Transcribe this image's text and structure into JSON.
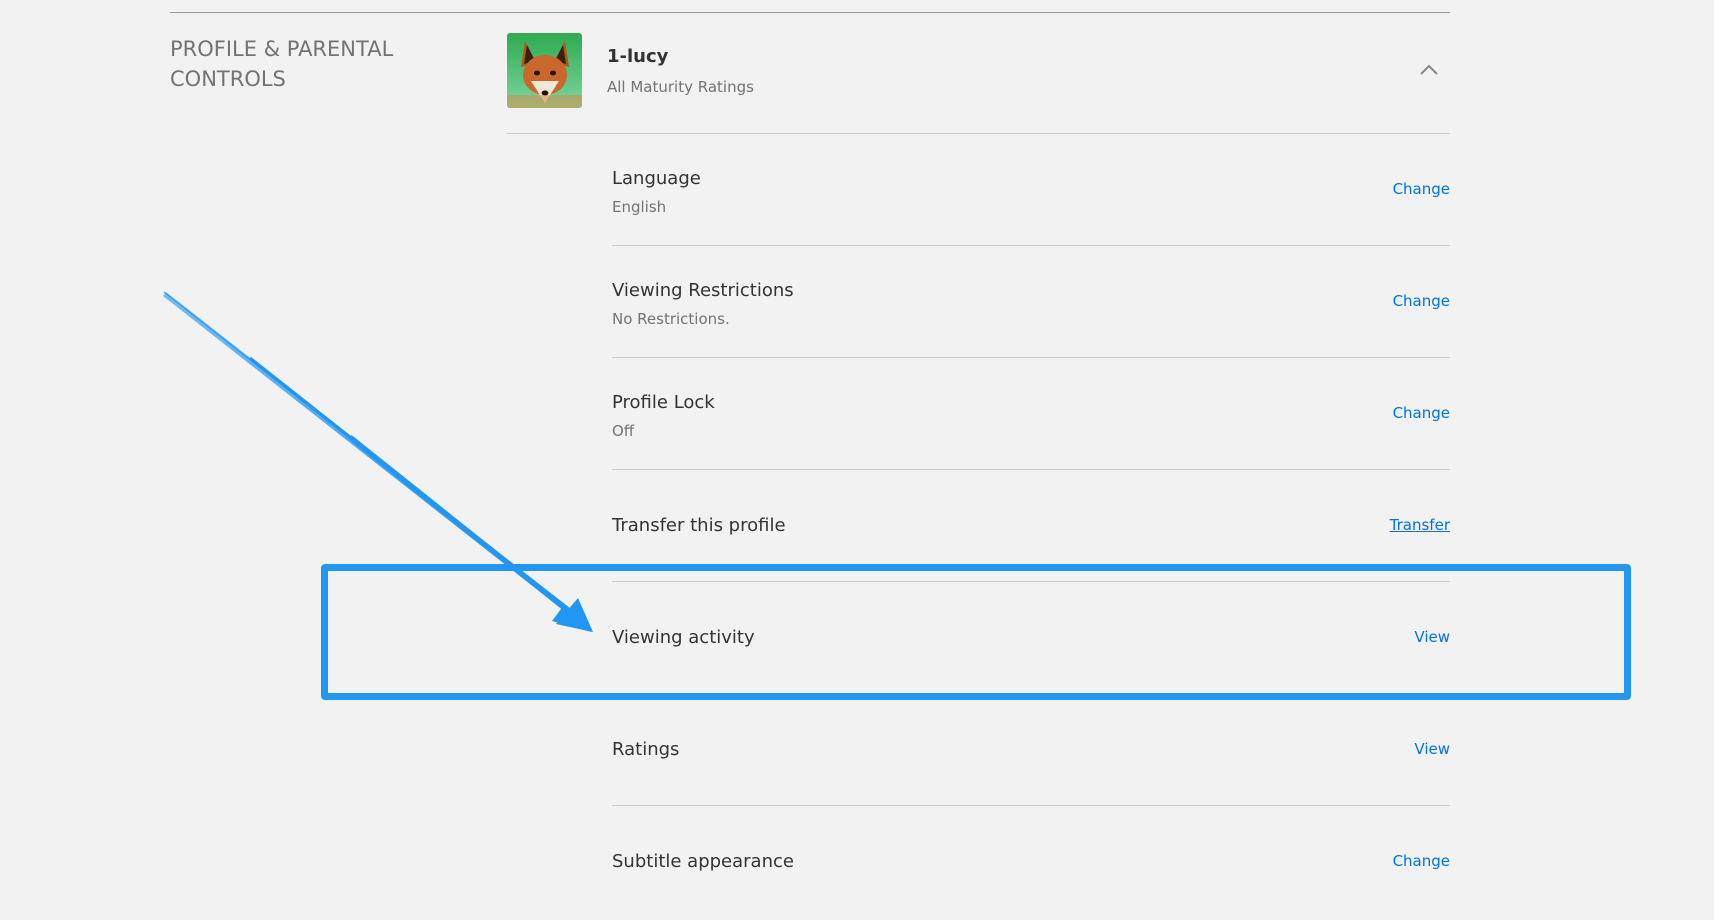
{
  "section": {
    "title": "PROFILE & PARENTAL CONTROLS"
  },
  "profile": {
    "name": "1-lucy",
    "subtitle": "All Maturity Ratings",
    "avatar_icon": "fox-avatar-icon"
  },
  "rows": [
    {
      "label": "Language",
      "value": "English",
      "action": "Change"
    },
    {
      "label": "Viewing Restrictions",
      "value": "No Restrictions.",
      "action": "Change"
    },
    {
      "label": "Profile Lock",
      "value": "Off",
      "action": "Change"
    },
    {
      "label": "Transfer this profile",
      "value": null,
      "action": "Transfer"
    },
    {
      "label": "Viewing activity",
      "value": null,
      "action": "View"
    },
    {
      "label": "Ratings",
      "value": null,
      "action": "View"
    },
    {
      "label": "Subtitle appearance",
      "value": null,
      "action": "Change"
    }
  ],
  "colors": {
    "background": "#f2f2f2",
    "link": "#0071eb",
    "annotation": "#2196f3"
  }
}
